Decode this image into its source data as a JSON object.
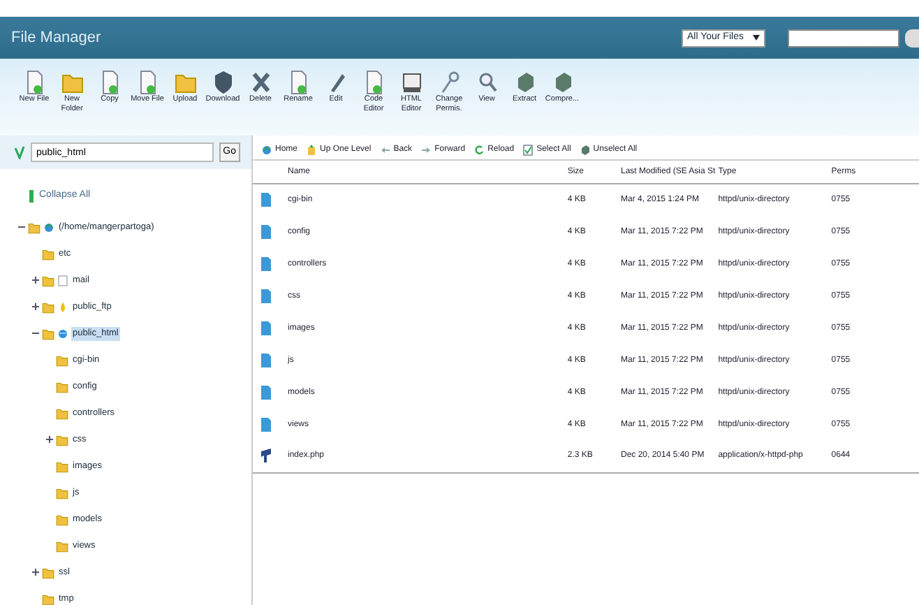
{
  "header": {
    "title": "File Manager",
    "scope_select": "All Your Files"
  },
  "toolbar": [
    {
      "label": "New File"
    },
    {
      "label": "New Folder"
    },
    {
      "label": "Copy"
    },
    {
      "label": "Move File"
    },
    {
      "label": "Upload"
    },
    {
      "label": "Download"
    },
    {
      "label": "Delete"
    },
    {
      "label": "Rename"
    },
    {
      "label": "Edit"
    },
    {
      "label": "Code Editor"
    },
    {
      "label": "HTML Editor"
    },
    {
      "label": "Change Permis."
    },
    {
      "label": "View"
    },
    {
      "label": "Extract"
    },
    {
      "label": "Compre..."
    }
  ],
  "path_field": {
    "value": "public_html",
    "button": "Go"
  },
  "collapse_all": "Collapse All",
  "tree": [
    {
      "label": "(/home/mangerpartoga)",
      "kind": "root",
      "expanded": true,
      "selected": false,
      "children": [
        {
          "label": "etc",
          "kind": "folder",
          "selected": false
        },
        {
          "label": "mail",
          "kind": "mail",
          "expanded": false,
          "selected": false
        },
        {
          "label": "public_ftp",
          "kind": "ftp",
          "expanded": false,
          "selected": false
        },
        {
          "label": "public_html",
          "kind": "web",
          "expanded": true,
          "selected": true,
          "children": [
            {
              "label": "cgi-bin",
              "kind": "folder",
              "selected": false
            },
            {
              "label": "config",
              "kind": "folder",
              "selected": false
            },
            {
              "label": "controllers",
              "kind": "folder",
              "selected": false
            },
            {
              "label": "css",
              "kind": "folder",
              "expanded": false,
              "selected": false
            },
            {
              "label": "images",
              "kind": "folder",
              "selected": false
            },
            {
              "label": "js",
              "kind": "folder",
              "selected": false
            },
            {
              "label": "models",
              "kind": "folder",
              "selected": false
            },
            {
              "label": "views",
              "kind": "folder",
              "selected": false
            }
          ]
        },
        {
          "label": "ssl",
          "kind": "folder",
          "expanded": false,
          "selected": false
        },
        {
          "label": "tmp",
          "kind": "folder",
          "selected": false
        }
      ]
    }
  ],
  "nav": [
    {
      "label": "Home"
    },
    {
      "label": "Up One Level"
    },
    {
      "label": "Back"
    },
    {
      "label": "Forward"
    },
    {
      "label": "Reload"
    },
    {
      "label": "Select All"
    },
    {
      "label": "Unselect All"
    }
  ],
  "table": {
    "columns": [
      "Name",
      "Size",
      "Last Modified (SE Asia St",
      "Type",
      "Perms"
    ],
    "rows": [
      {
        "kind": "folder",
        "cells": [
          "cgi-bin",
          "4 KB",
          "Mar 4, 2015 1:24 PM",
          "httpd/unix-directory",
          "0755"
        ]
      },
      {
        "kind": "folder",
        "cells": [
          "config",
          "4 KB",
          "Mar 11, 2015 7:22 PM",
          "httpd/unix-directory",
          "0755"
        ]
      },
      {
        "kind": "folder",
        "cells": [
          "controllers",
          "4 KB",
          "Mar 11, 2015 7:22 PM",
          "httpd/unix-directory",
          "0755"
        ]
      },
      {
        "kind": "folder",
        "cells": [
          "css",
          "4 KB",
          "Mar 11, 2015 7:22 PM",
          "httpd/unix-directory",
          "0755"
        ]
      },
      {
        "kind": "folder",
        "cells": [
          "images",
          "4 KB",
          "Mar 11, 2015 7:22 PM",
          "httpd/unix-directory",
          "0755"
        ]
      },
      {
        "kind": "folder",
        "cells": [
          "js",
          "4 KB",
          "Mar 11, 2015 7:22 PM",
          "httpd/unix-directory",
          "0755"
        ]
      },
      {
        "kind": "folder",
        "cells": [
          "models",
          "4 KB",
          "Mar 11, 2015 7:22 PM",
          "httpd/unix-directory",
          "0755"
        ]
      },
      {
        "kind": "folder",
        "cells": [
          "views",
          "4 KB",
          "Mar 11, 2015 7:22 PM",
          "httpd/unix-directory",
          "0755"
        ]
      },
      {
        "kind": "php",
        "cells": [
          "index.php",
          "2.3 KB",
          "Dec 20, 2014 5:40 PM",
          "application/x-httpd-php",
          "0644"
        ]
      }
    ]
  }
}
